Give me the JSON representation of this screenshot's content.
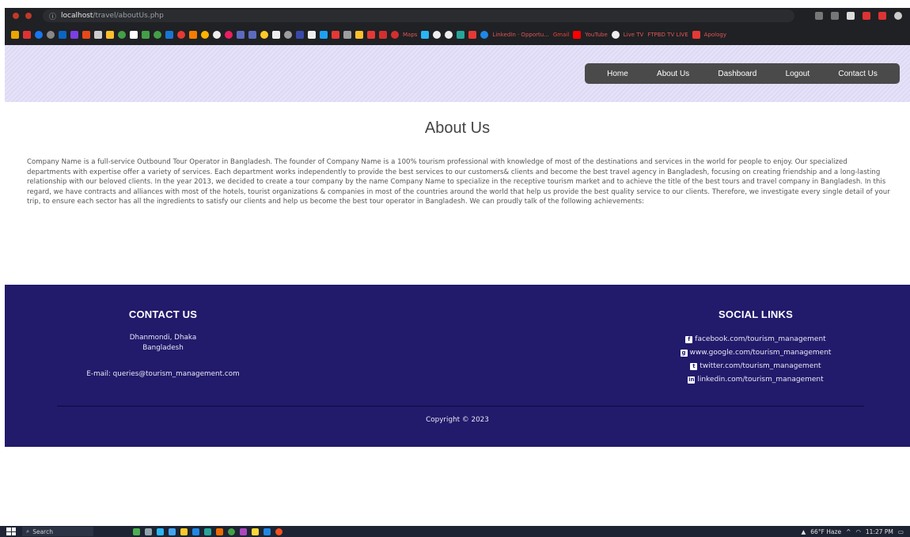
{
  "browser": {
    "url_host": "localhost",
    "url_path": "/travel/aboutUs.php"
  },
  "bookmarks": {
    "visible_labels": [
      "Maps",
      "LinkedIn · Opportu...",
      "Gmail",
      "YouTube",
      "Live TV",
      "FTPBD TV LIVE",
      "Apology"
    ]
  },
  "nav": {
    "items": [
      "Home",
      "About Us",
      "Dashboard",
      "Logout",
      "Contact Us"
    ]
  },
  "main": {
    "title": "About Us",
    "paragraph": "Company Name is a full-service Outbound Tour Operator in Bangladesh. The founder of Company Name is a 100% tourism professional with knowledge of most of the destinations and services in the world for people to enjoy. Our specialized departments with expertise offer a variety of services. Each department works independently to provide the best services to our customers& clients and become the best travel agency in Bangladesh, focusing on creating friendship and a long-lasting relationship with our beloved clients. In the year 2013, we decided to create a tour company by the name Company Name to specialize in the receptive tourism market and to achieve the title of the best tours and travel company in Bangladesh. In this regard, we have contracts and alliances with most of the hotels, tourist organizations & companies in most of the countries around the world that help us provide the best quality service to our clients. Therefore, we investigate every single detail of your trip, to ensure each sector has all the ingredients to satisfy our clients and help us become the best tour operator in Bangladesh. We can proudly talk of the following achievements:"
  },
  "footer": {
    "contact": {
      "heading": "CONTACT US",
      "address_line1": "Dhanmondi, Dhaka",
      "address_line2": "Bangladesh",
      "email": "E-mail: queries@tourism_management.com"
    },
    "social": {
      "heading": "SOCIAL LINKS",
      "links": [
        {
          "icon": "facebook-icon",
          "glyph": "f",
          "text": "facebook.com/tourism_management"
        },
        {
          "icon": "google-plus-icon",
          "glyph": "g",
          "text": "www.google.com/tourism_management"
        },
        {
          "icon": "twitter-icon",
          "glyph": "t",
          "text": "twitter.com/tourism_management"
        },
        {
          "icon": "linkedin-icon",
          "glyph": "in",
          "text": "linkedin.com/tourism_management"
        }
      ]
    },
    "copyright": "Copyright © 2023"
  },
  "taskbar": {
    "search_placeholder": "Search",
    "weather": "66°F Haze",
    "time": "11:27 PM"
  },
  "colors": {
    "footer_bg": "#221a6b",
    "nav_bg": "#4a4a4a",
    "header_bg": "#ddd9f5",
    "chrome_bg": "#202124"
  }
}
